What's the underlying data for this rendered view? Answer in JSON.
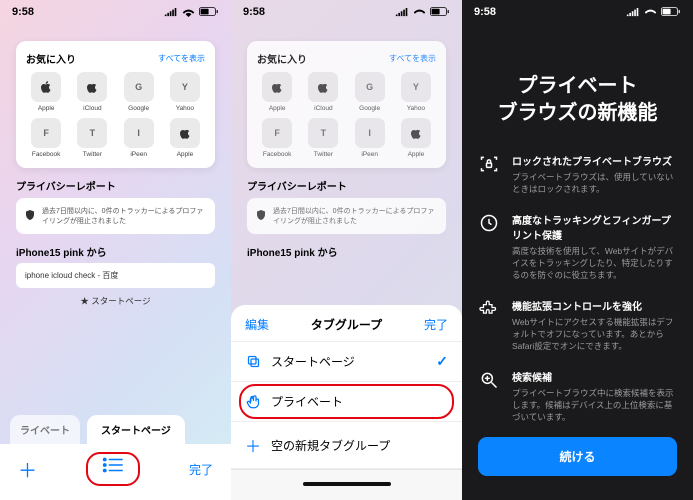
{
  "status": {
    "time": "9:58"
  },
  "favorites": {
    "title": "お気に入り",
    "showAll": "すべてを表示",
    "items": [
      {
        "label": "Apple",
        "icon": "apple"
      },
      {
        "label": "iCloud",
        "icon": "apple"
      },
      {
        "label": "Google",
        "letter": "G"
      },
      {
        "label": "Yahoo",
        "letter": "Y"
      },
      {
        "label": "Facebook",
        "letter": "F"
      },
      {
        "label": "Twitter",
        "letter": "T"
      },
      {
        "label": "iPeen",
        "letter": "I"
      },
      {
        "label": "Apple",
        "icon": "apple"
      }
    ]
  },
  "privacy": {
    "title": "プライバシーレポート",
    "body": "過去7日間以内に、0件のトラッカーによるプロファイリングが阻止されました"
  },
  "from": {
    "title": "iPhone15 pink から",
    "item": "iphone icloud check - 百度"
  },
  "startPageLabel": "★ スタートページ",
  "tabs": {
    "private": "ライベート",
    "start": "スタートページ"
  },
  "toolbar": {
    "done": "完了"
  },
  "sheet": {
    "edit": "編集",
    "title": "タブグループ",
    "done": "完了",
    "rows": [
      {
        "label": "スタートページ",
        "checked": true
      },
      {
        "label": "プライベート"
      },
      {
        "label": "空の新規タブグループ"
      }
    ]
  },
  "p3": {
    "title1": "プライベート",
    "title2": "ブラウズの新機能",
    "features": [
      {
        "title": "ロックされたプライベートブラウズ",
        "desc": "プライベートブラウズは、使用していないときはロックされます。"
      },
      {
        "title": "高度なトラッキングとフィンガープリント保護",
        "desc": "高度な技術を使用して、Webサイトがデバイスをトラッキングしたり、特定したりするのを防ぐのに役立ちます。"
      },
      {
        "title": "機能拡張コントロールを強化",
        "desc": "Webサイトにアクセスする機能拡張はデフォルトでオフになっています。あとからSafari設定でオンにできます。"
      },
      {
        "title": "検索候補",
        "desc": "プライベートブラウズ中に検索候補を表示します。候補はデバイス上の上位検索に基づいています。"
      }
    ],
    "continue": "続ける"
  }
}
